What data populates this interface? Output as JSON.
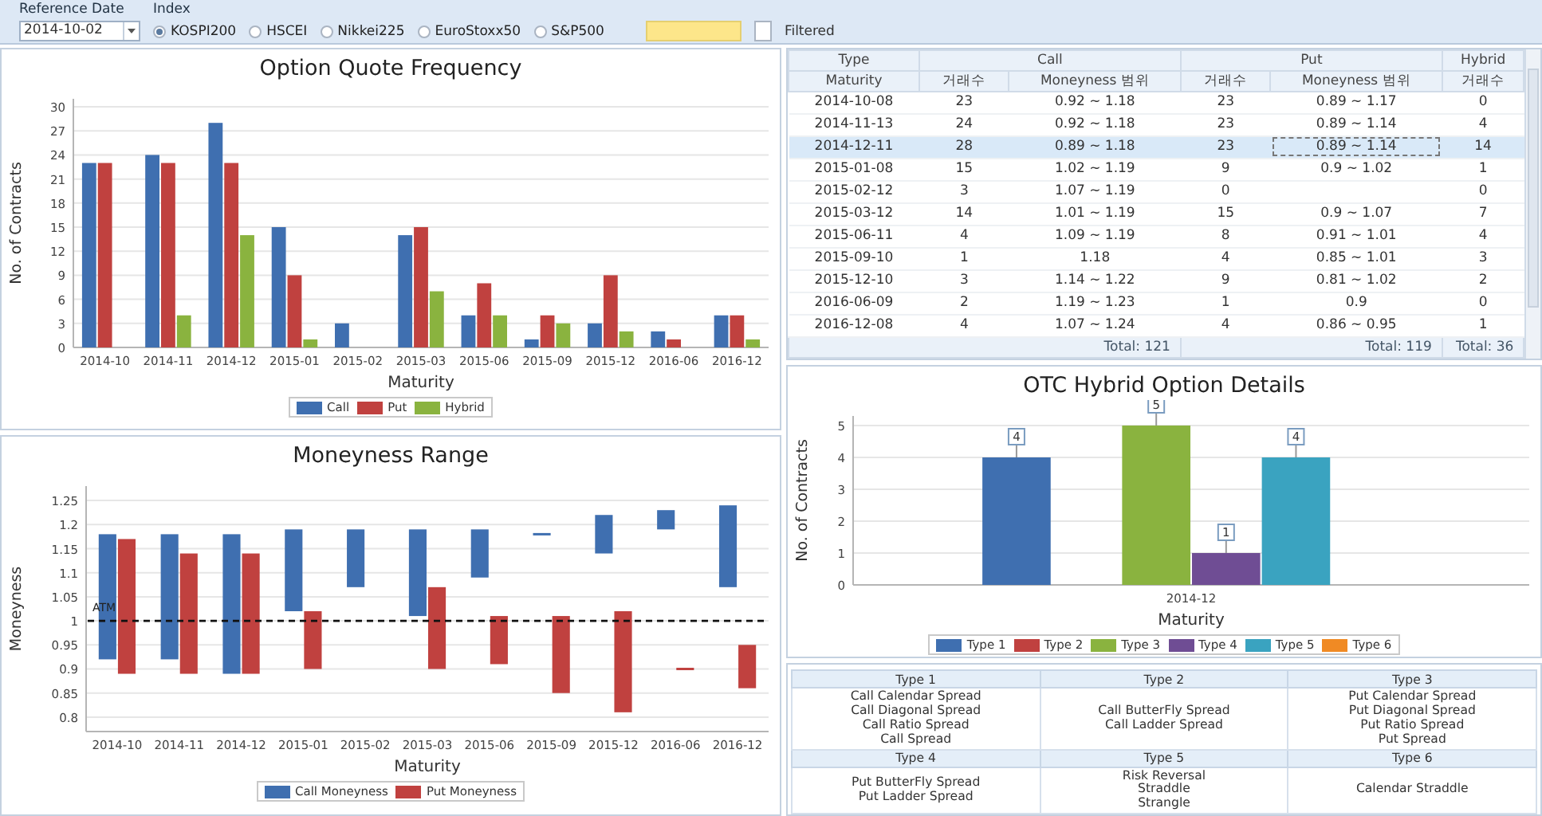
{
  "toolbar": {
    "reference_date_label": "Reference Date",
    "reference_date": "2014-10-02",
    "index_label": "Index",
    "indices": [
      {
        "label": "KOSPI200",
        "selected": true
      },
      {
        "label": "HSCEI",
        "selected": false
      },
      {
        "label": "Nikkei225",
        "selected": false
      },
      {
        "label": "EuroStoxx50",
        "selected": false
      },
      {
        "label": "S&P500",
        "selected": false
      }
    ],
    "filter": {
      "label": "Filtered",
      "checked": false
    }
  },
  "quote_frequency": {
    "title": "Option Quote Frequency",
    "chart_data": {
      "type": "bar",
      "xlabel": "Maturity",
      "ylabel": "No. of Contracts",
      "categories": [
        "2014-10",
        "2014-11",
        "2014-12",
        "2015-01",
        "2015-02",
        "2015-03",
        "2015-06",
        "2015-09",
        "2015-12",
        "2016-06",
        "2016-12"
      ],
      "ylim": [
        0,
        31
      ],
      "grid": true,
      "yticks": [
        0,
        3,
        6,
        9,
        12,
        15,
        18,
        21,
        24,
        27,
        30
      ],
      "series": [
        {
          "name": "Call",
          "color": "#3f6fb0",
          "values": [
            23,
            24,
            28,
            15,
            3,
            14,
            4,
            1,
            3,
            2,
            4
          ]
        },
        {
          "name": "Put",
          "color": "#c0413f",
          "values": [
            23,
            23,
            23,
            9,
            0,
            15,
            8,
            4,
            9,
            1,
            4
          ]
        },
        {
          "name": "Hybrid",
          "color": "#8ab33f",
          "values": [
            0,
            4,
            14,
            1,
            0,
            7,
            4,
            3,
            2,
            0,
            1
          ]
        }
      ]
    }
  },
  "moneyness_range": {
    "title": "Moneyness Range",
    "chart_data": {
      "type": "bar",
      "xlabel": "Maturity",
      "ylabel": "Moneyness",
      "categories": [
        "2014-10",
        "2014-11",
        "2014-12",
        "2015-01",
        "2015-02",
        "2015-03",
        "2015-06",
        "2015-09",
        "2015-12",
        "2016-06",
        "2016-12"
      ],
      "ylim": [
        0.77,
        1.28
      ],
      "grid": true,
      "yticks": [
        {
          "value": 0.8,
          "label": "0.8"
        },
        {
          "value": 0.85,
          "label": "0.85"
        },
        {
          "value": 0.9,
          "label": "0.9"
        },
        {
          "value": 0.95,
          "label": "0.95"
        },
        {
          "value": 1,
          "label": "1"
        },
        {
          "value": 1.05,
          "label": "1.05"
        },
        {
          "value": 1.1,
          "label": "1.1"
        },
        {
          "value": 1.15,
          "label": "1.15"
        },
        {
          "value": 1.2,
          "label": "1.2"
        },
        {
          "value": 1.25,
          "label": "1.25"
        }
      ],
      "series": [
        {
          "name": "Call Moneyness",
          "color": "#3f6fb0",
          "base": [
            0.92,
            0.92,
            0.89,
            1.02,
            1.07,
            1.01,
            1.09,
            1.18,
            1.14,
            1.19,
            1.07
          ],
          "values": [
            0.26,
            0.26,
            0.29,
            0.17,
            0.12,
            0.18,
            0.1,
            0,
            0.08,
            0.04,
            0.17
          ]
        },
        {
          "name": "Put Moneyness",
          "color": "#c0413f",
          "base": [
            0.89,
            0.89,
            0.89,
            0.9,
            null,
            0.9,
            0.91,
            0.85,
            0.81,
            0.9,
            0.86
          ],
          "values": [
            0.28,
            0.25,
            0.25,
            0.12,
            null,
            0.17,
            0.1,
            0.16,
            0.21,
            0,
            0.09
          ]
        }
      ],
      "ref_lines": [
        {
          "axis": "y",
          "value": 1,
          "label": "ATM"
        }
      ]
    }
  },
  "contract_table": {
    "group_headers": [
      "Type",
      "Call",
      "Put",
      "Hybrid"
    ],
    "columns": [
      "Maturity",
      "거래수",
      "Moneyness 범위",
      "거래수",
      "Moneyness 범위",
      "거래수"
    ],
    "rows": [
      {
        "cells": [
          "2014-10-08",
          "23",
          "0.92 ~ 1.18",
          "23",
          "0.89 ~ 1.17",
          "0"
        ],
        "selected": false
      },
      {
        "cells": [
          "2014-11-13",
          "24",
          "0.92 ~ 1.18",
          "23",
          "0.89 ~ 1.14",
          "4"
        ],
        "selected": false
      },
      {
        "cells": [
          "2014-12-11",
          "28",
          "0.89 ~ 1.18",
          "23",
          "0.89 ~ 1.14",
          "14"
        ],
        "selected": true
      },
      {
        "cells": [
          "2015-01-08",
          "15",
          "1.02 ~ 1.19",
          "9",
          "0.9 ~ 1.02",
          "1"
        ],
        "selected": false
      },
      {
        "cells": [
          "2015-02-12",
          "3",
          "1.07 ~ 1.19",
          "0",
          "",
          "0"
        ],
        "selected": false
      },
      {
        "cells": [
          "2015-03-12",
          "14",
          "1.01 ~ 1.19",
          "15",
          "0.9 ~ 1.07",
          "7"
        ],
        "selected": false
      },
      {
        "cells": [
          "2015-06-11",
          "4",
          "1.09 ~ 1.19",
          "8",
          "0.91 ~ 1.01",
          "4"
        ],
        "selected": false
      },
      {
        "cells": [
          "2015-09-10",
          "1",
          "1.18",
          "4",
          "0.85 ~ 1.01",
          "3"
        ],
        "selected": false
      },
      {
        "cells": [
          "2015-12-10",
          "3",
          "1.14 ~ 1.22",
          "9",
          "0.81 ~ 1.02",
          "2"
        ],
        "selected": false
      },
      {
        "cells": [
          "2016-06-09",
          "2",
          "1.19 ~ 1.23",
          "1",
          "0.9",
          "0"
        ],
        "selected": false
      },
      {
        "cells": [
          "2016-12-08",
          "4",
          "1.07 ~ 1.24",
          "4",
          "0.86 ~ 0.95",
          "1"
        ],
        "selected": false
      }
    ],
    "totals": [
      "Total: 121",
      "Total: 119",
      "Total: 36"
    ]
  },
  "hybrid_details": {
    "title": "OTC Hybrid Option Details",
    "chart_data": {
      "type": "bar",
      "xlabel": "Maturity",
      "ylabel": "No. of Contracts",
      "categories": [
        "2014-12"
      ],
      "ylim": [
        0,
        5.3
      ],
      "grid": true,
      "yticks": [
        0,
        1,
        2,
        3,
        4,
        5
      ],
      "value_labels": [
        [
          "4"
        ],
        [
          null
        ],
        [
          "5"
        ],
        [
          "1"
        ],
        [
          "4"
        ],
        [
          null
        ]
      ],
      "series": [
        {
          "name": "Type 1",
          "color": "#3f6fb0",
          "values": [
            4
          ]
        },
        {
          "name": "Type 2",
          "color": "#c0413f",
          "values": [
            0
          ]
        },
        {
          "name": "Type 3",
          "color": "#8ab33f",
          "values": [
            5
          ]
        },
        {
          "name": "Type 4",
          "color": "#6f4d94",
          "values": [
            1
          ]
        },
        {
          "name": "Type 5",
          "color": "#3aa3c0",
          "values": [
            4
          ]
        },
        {
          "name": "Type 6",
          "color": "#f08a24",
          "values": [
            0
          ]
        }
      ]
    }
  },
  "type_legend": [
    {
      "label": "Type 1",
      "strategies": [
        "Call Calendar Spread",
        "Call Diagonal Spread",
        "Call Ratio Spread",
        "Call Spread"
      ]
    },
    {
      "label": "Type 2",
      "strategies": [
        "Call ButterFly Spread",
        "Call Ladder Spread"
      ]
    },
    {
      "label": "Type 3",
      "strategies": [
        "Put Calendar Spread",
        "Put Diagonal Spread",
        "Put Ratio Spread",
        "Put Spread"
      ]
    },
    {
      "label": "Type 4",
      "strategies": [
        "Put ButterFly Spread",
        "Put Ladder Spread"
      ]
    },
    {
      "label": "Type 5",
      "strategies": [
        "Risk Reversal",
        "Straddle",
        "Strangle"
      ]
    },
    {
      "label": "Type 6",
      "strategies": [
        "Calendar Straddle"
      ]
    }
  ]
}
